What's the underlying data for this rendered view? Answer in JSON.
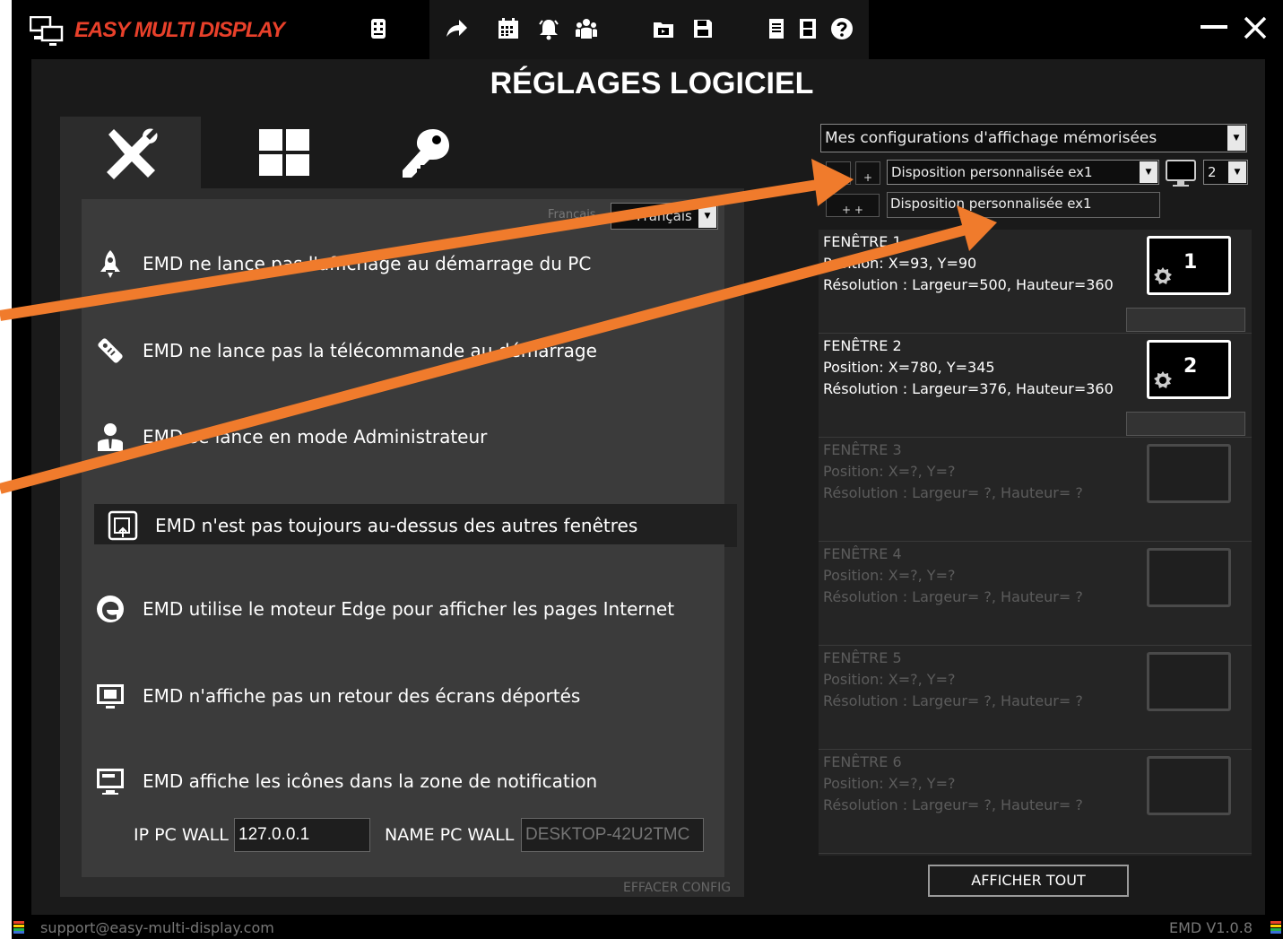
{
  "app": {
    "name": "EASY MULTI DISPLAY",
    "title": "RÉGLAGES LOGICIEL",
    "brand_color": "#e8402a",
    "toolbar_icons": [
      "remote-icon",
      "share-arrow-icon",
      "calendar-icon",
      "alarm-bell-icon",
      "group-icon",
      "media-folder-icon",
      "save-disk-icon",
      "notes-icon",
      "film-icon",
      "help-icon"
    ],
    "window_controls": {
      "minimize_icon": "minimize-icon",
      "close_icon": "close-icon"
    }
  },
  "tabs": [
    {
      "name": "tools",
      "icon": "tools-icon",
      "active": true
    },
    {
      "name": "layout",
      "icon": "grid-layout-icon",
      "active": false
    },
    {
      "name": "license",
      "icon": "key-icon",
      "active": false
    }
  ],
  "settings": {
    "language_label": "Français",
    "language_value": "Français",
    "options": [
      {
        "icon": "rocket-icon",
        "label": "EMD ne lance pas l'affichage au démarrage du PC"
      },
      {
        "icon": "remote-control-icon",
        "label": "EMD ne lance pas la télécommande au démarrage"
      },
      {
        "icon": "admin-user-icon",
        "label": "EMD se lance en mode Administrateur"
      },
      {
        "icon": "window-on-top-icon",
        "label": "EMD n'est pas toujours au-dessus des autres fenêtres"
      },
      {
        "icon": "edge-browser-icon",
        "label": "EMD utilise le moteur Edge pour afficher les pages Internet"
      },
      {
        "icon": "remote-screen-icon",
        "label": "EMD n'affiche pas un retour des écrans déportés"
      },
      {
        "icon": "notification-tray-icon",
        "label": "EMD affiche les icônes dans la zone de notification"
      }
    ],
    "ip_label": "IP PC WALL",
    "ip_value": "127.0.0.1",
    "name_label": "NAME PC WALL",
    "name_placeholder": "DESKTOP-42U2TMC",
    "clear_config": "EFFACER CONFIG"
  },
  "configs": {
    "saved_configs": "Mes configurations d'affichage mémorisées",
    "btn_minus": "",
    "btn_plus": "+",
    "btn_plusplus": "+ +",
    "layout_selected": "Disposition personnalisée ex1",
    "layout_name": "Disposition personnalisée ex1",
    "screen_count": "2"
  },
  "windows": [
    {
      "title": "FENÊTRE 1",
      "position": "Position: X=93, Y=90",
      "resolution": "Résolution : Largeur=500, Hauteur=360",
      "number": "1",
      "active": true
    },
    {
      "title": "FENÊTRE 2",
      "position": "Position: X=780, Y=345",
      "resolution": "Résolution : Largeur=376, Hauteur=360",
      "number": "2",
      "active": true
    },
    {
      "title": "FENÊTRE 3",
      "position": "Position: X=?, Y=?",
      "resolution": "Résolution : Largeur= ?, Hauteur= ?",
      "number": "",
      "active": false
    },
    {
      "title": "FENÊTRE 4",
      "position": "Position: X=?, Y=?",
      "resolution": "Résolution : Largeur= ?, Hauteur= ?",
      "number": "",
      "active": false
    },
    {
      "title": "FENÊTRE 5",
      "position": "Position: X=?, Y=?",
      "resolution": "Résolution : Largeur= ?, Hauteur= ?",
      "number": "",
      "active": false
    },
    {
      "title": "FENÊTRE 6",
      "position": "Position: X=?, Y=?",
      "resolution": "Résolution : Largeur= ?, Hauteur= ?",
      "number": "",
      "active": false
    }
  ],
  "show_all_button": "AFFICHER TOUT",
  "status": {
    "email": "support@easy-multi-display.com",
    "version": "EMD V1.0.8"
  },
  "annotation_color": "#f07b2c"
}
